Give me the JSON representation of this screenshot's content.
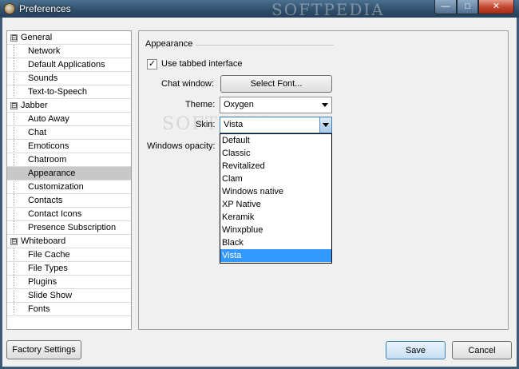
{
  "window": {
    "title": "Preferences",
    "watermark": "SOFTPEDIA",
    "minimize": "—",
    "maximize": "□",
    "close": "✕"
  },
  "tree": {
    "categories": [
      {
        "label": "General",
        "expander": "⊟",
        "children": [
          "Network",
          "Default Applications",
          "Sounds",
          "Text-to-Speech"
        ]
      },
      {
        "label": "Jabber",
        "expander": "⊟",
        "children": [
          "Auto Away",
          "Chat",
          "Emoticons",
          "Chatroom",
          "Appearance",
          "Customization",
          "Contacts",
          "Contact Icons",
          "Presence Subscription"
        ]
      },
      {
        "label": "Whiteboard",
        "expander": "⊟",
        "children": [
          "File Cache",
          "File Types",
          "Plugins",
          "Slide Show",
          "Fonts"
        ]
      }
    ],
    "selected": "Appearance"
  },
  "appearance": {
    "section_title": "Appearance",
    "tabbed_checkbox_checked": true,
    "tabbed_label": "Use tabbed interface",
    "chat_window_label": "Chat window:",
    "select_font_button": "Select Font...",
    "theme_label": "Theme:",
    "theme_value": "Oxygen",
    "skin_label": "Skin:",
    "skin_value": "Vista",
    "opacity_label": "Windows opacity:",
    "skin_options": [
      "Default",
      "Classic",
      "Revitalized",
      "Clam",
      "Windows native",
      "XP Native",
      "Keramik",
      "Winxpblue",
      "Black",
      "Vista"
    ],
    "skin_selected_index": 9,
    "checkmark": "✓"
  },
  "footer": {
    "factory_settings": "Factory Settings",
    "save": "Save",
    "cancel": "Cancel"
  }
}
